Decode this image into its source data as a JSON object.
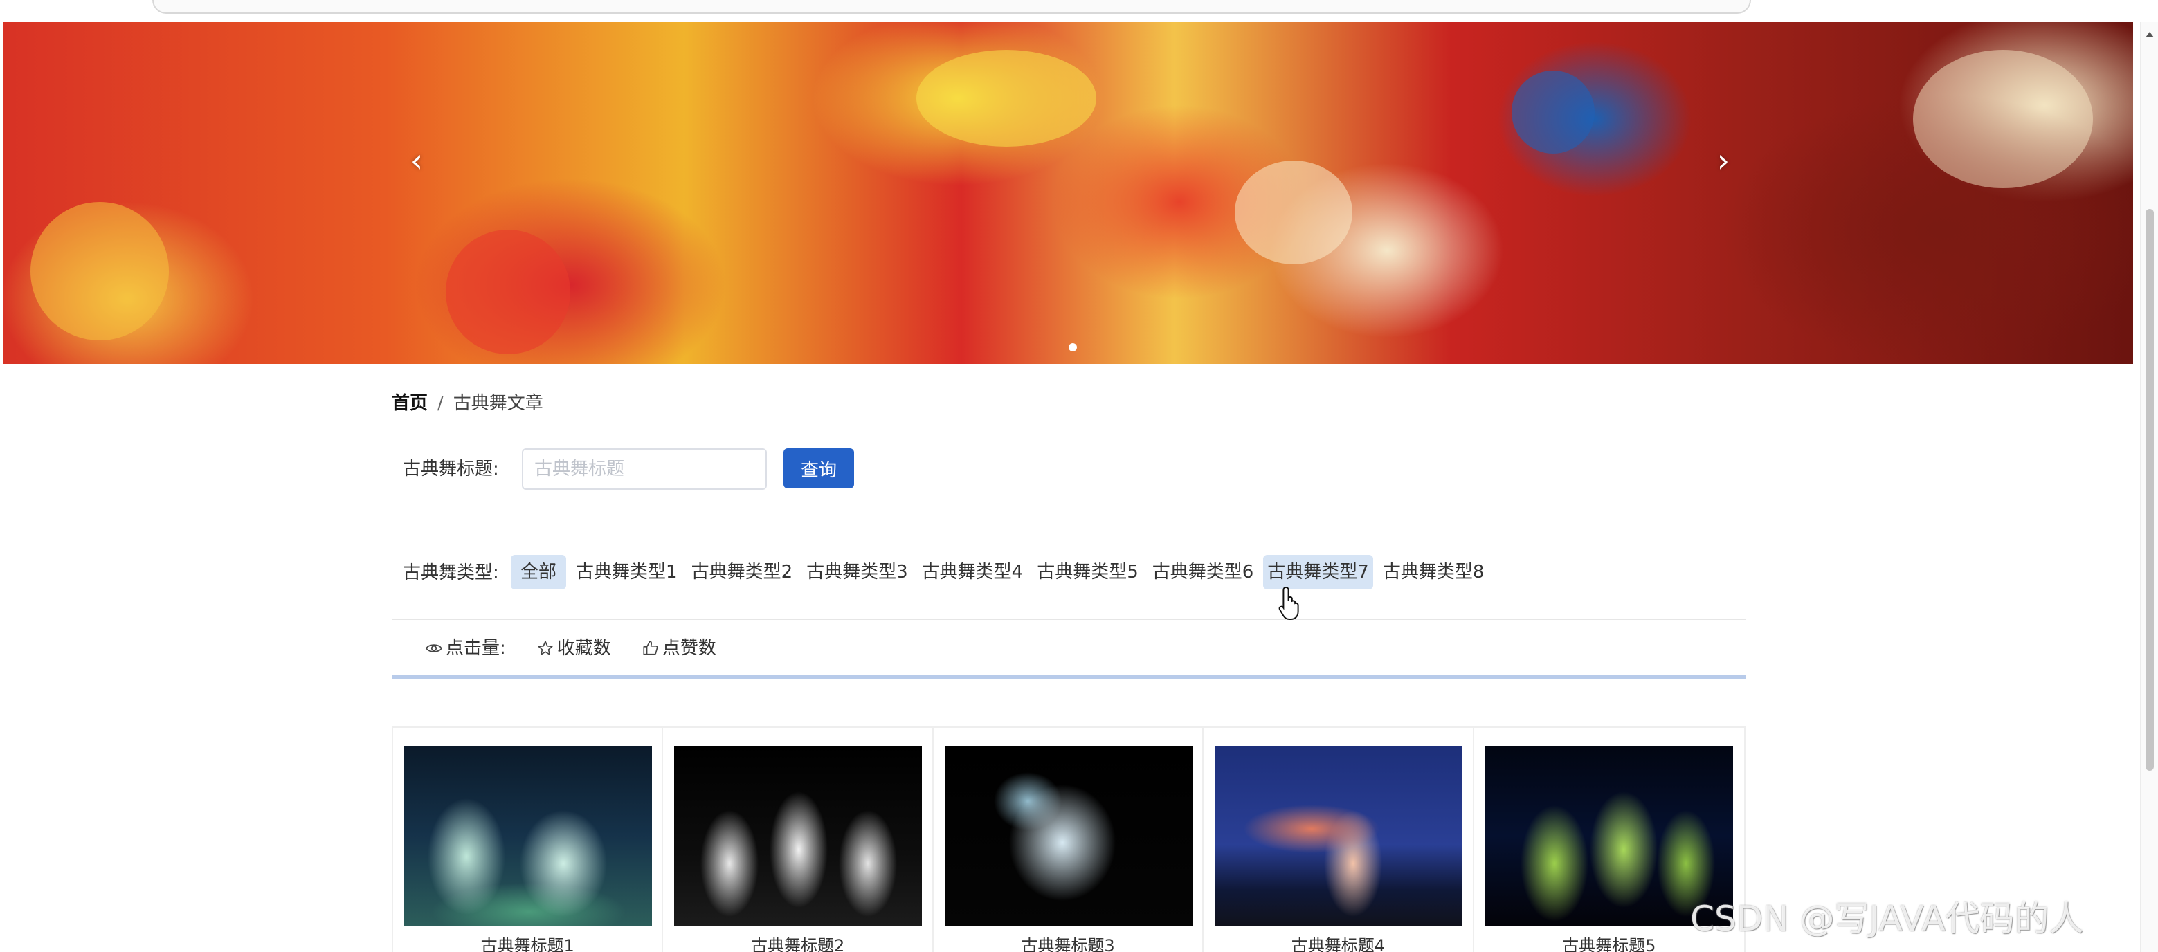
{
  "breadcrumb": {
    "home": "首页",
    "separator": "/",
    "current": "古典舞文章"
  },
  "search": {
    "label": "古典舞标题:",
    "placeholder": "古典舞标题",
    "value": "",
    "button": "查询"
  },
  "type_filter": {
    "label": "古典舞类型:",
    "options": [
      "全部",
      "古典舞类型1",
      "古典舞类型2",
      "古典舞类型3",
      "古典舞类型4",
      "古典舞类型5",
      "古典舞类型6",
      "古典舞类型7",
      "古典舞类型8"
    ],
    "selected": "全部",
    "hovered": "古典舞类型7"
  },
  "sort": {
    "items": [
      {
        "label": "点击量:",
        "icon": "eye-icon"
      },
      {
        "label": "收藏数",
        "icon": "star-icon"
      },
      {
        "label": "点赞数",
        "icon": "thumbs-up-icon"
      }
    ]
  },
  "cards": [
    {
      "title": "古典舞标题1"
    },
    {
      "title": "古典舞标题2"
    },
    {
      "title": "古典舞标题3"
    },
    {
      "title": "古典舞标题4"
    },
    {
      "title": "古典舞标题5"
    }
  ],
  "banner": {
    "prev_icon": "chevron-left-icon",
    "next_icon": "chevron-right-icon",
    "arrow_prev": "‹",
    "arrow_next": "›"
  },
  "watermark": "CSDN @写JAVA代码的人",
  "colors": {
    "primary": "#2562c8",
    "active_tag": "#d6e4f5",
    "underline": "#b8cbea"
  }
}
